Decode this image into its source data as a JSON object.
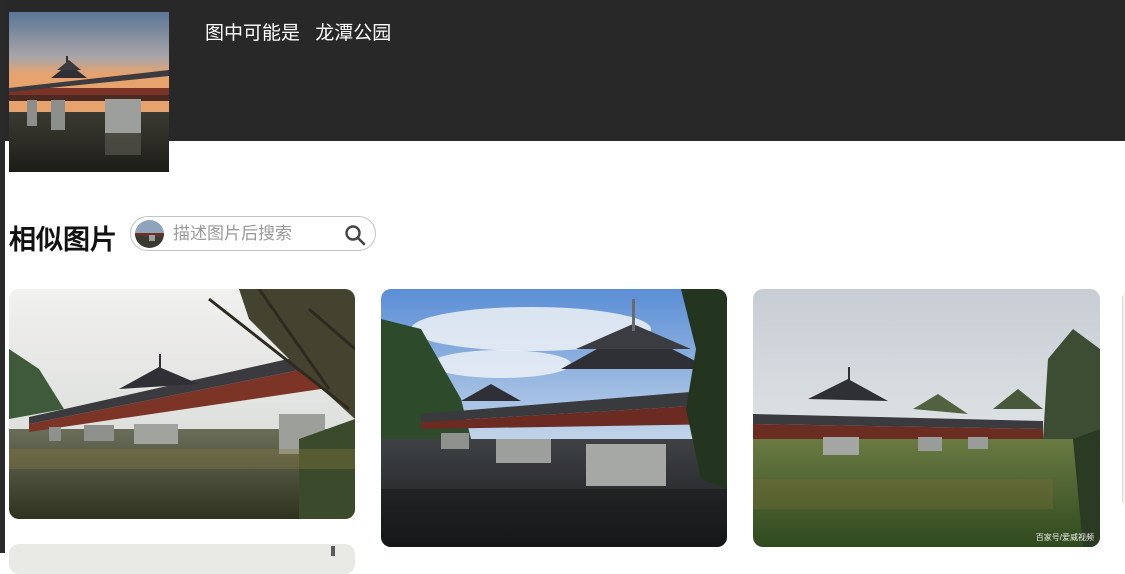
{
  "header": {
    "guess_prefix": "图中可能是",
    "guess_name": "龙潭公园"
  },
  "similar": {
    "title": "相似图片",
    "search_placeholder": "描述图片后搜索"
  },
  "cards": [
    {
      "watermark": ""
    },
    {
      "watermark": ""
    },
    {
      "watermark": "百家号/爱威视频"
    }
  ],
  "icons": {
    "search": "search-icon"
  }
}
